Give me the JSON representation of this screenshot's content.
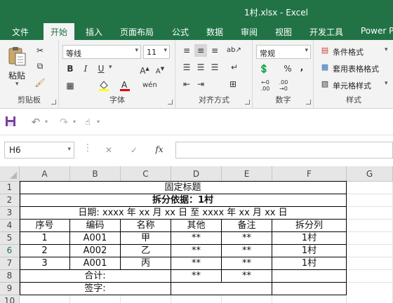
{
  "app": {
    "window_title": "1村.xlsx - Excel"
  },
  "ribbon": {
    "tabs": [
      "文件",
      "开始",
      "插入",
      "页面布局",
      "公式",
      "数据",
      "审阅",
      "视图",
      "开发工具",
      "Power P"
    ],
    "active_tab": "开始",
    "clipboard": {
      "label": "剪贴板",
      "paste": "粘贴"
    },
    "font": {
      "label": "字体",
      "name": "等线",
      "size": "11",
      "bold": "B",
      "italic": "I",
      "underline": "U"
    },
    "alignment": {
      "label": "对齐方式"
    },
    "number": {
      "label": "数字",
      "format": "常规",
      "percent": "%",
      "comma": ","
    },
    "styles": {
      "label": "样式",
      "conditional": "条件格式",
      "table": "套用表格格式",
      "cell": "单元格样式"
    }
  },
  "formula_bar": {
    "name_box": "H6",
    "fx": "fx"
  },
  "columns": [
    "A",
    "B",
    "C",
    "D",
    "E",
    "F",
    "G"
  ],
  "rows": [
    "1",
    "2",
    "3",
    "4",
    "5",
    "6",
    "7",
    "8",
    "9",
    "10"
  ],
  "sheet": {
    "title": "固定标题",
    "subtitle": "拆分依据：1村",
    "date_line": "日期:  xxxx 年 xx 月 xx 日 至 xxxx 年 xx 月 xx 日",
    "headers": [
      "序号",
      "编码",
      "名称",
      "其他",
      "备注",
      "拆分列"
    ],
    "data_rows": [
      [
        "1",
        "A001",
        "甲",
        "**",
        "**",
        "1村"
      ],
      [
        "2",
        "A002",
        "乙",
        "**",
        "**",
        "1村"
      ],
      [
        "3",
        "A001",
        "丙",
        "**",
        "**",
        "1村"
      ]
    ],
    "total_label": "合计:",
    "total_values": [
      "**",
      "**"
    ],
    "sign_label": "签字:"
  }
}
